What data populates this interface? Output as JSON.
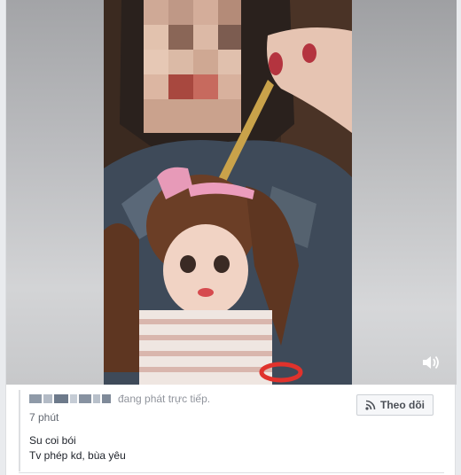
{
  "post": {
    "live_status": "đang phát trực tiếp.",
    "time": "7 phút",
    "text_line1": "Su coi bói",
    "text_line2": "Tv phép kd, bùa yêu",
    "follow_label": "Theo dõi"
  },
  "icons": {
    "volume": "volume-icon",
    "rss": "rss-icon"
  },
  "colors": {
    "secondary_text": "#90949c",
    "primary_text": "#1d2129",
    "button_bg": "#f6f7f9",
    "button_border": "#ccd0d5"
  }
}
